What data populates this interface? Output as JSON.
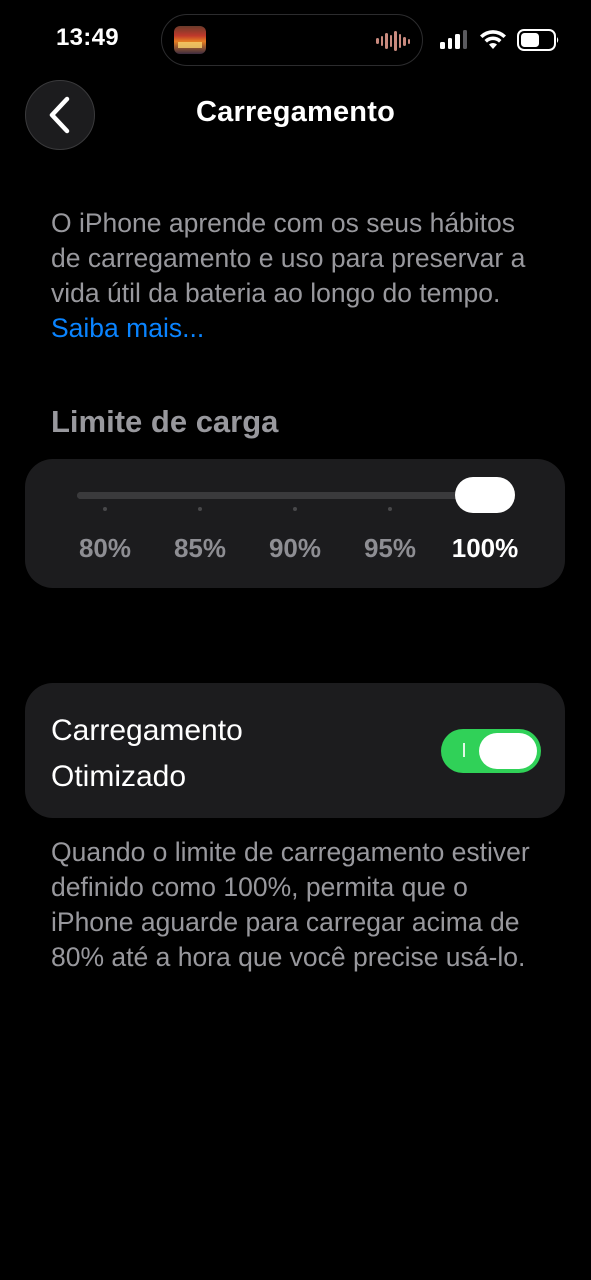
{
  "status_bar": {
    "time": "13:49",
    "icons": [
      "now-playing-artwork",
      "audio-waveform-icon",
      "cellular-signal-icon",
      "wifi-icon",
      "battery-icon"
    ]
  },
  "nav": {
    "back_icon": "chevron-left-icon",
    "title": "Carregamento"
  },
  "intro": {
    "text": "O iPhone aprende com os seus hábitos de carregamento e uso para preservar a vida útil da bateria ao longo do tempo.",
    "link_label": "Saiba mais..."
  },
  "charge_limit": {
    "header": "Limite de carga",
    "options": [
      "80%",
      "85%",
      "90%",
      "95%",
      "100%"
    ],
    "selected_index": 4
  },
  "optimized_charging": {
    "label_line1": "Carregamento",
    "label_line2": "Otimizado",
    "enabled": true
  },
  "footnote": "Quando o limite de carregamento estiver definido como 100%, permita que o iPhone aguarde para carregar acima de 80% até a hora que você precise usá-lo.",
  "colors": {
    "background": "#000000",
    "card": "#1c1c1e",
    "secondary_text": "#98989d",
    "link": "#0a84ff",
    "toggle_on": "#30d158"
  }
}
